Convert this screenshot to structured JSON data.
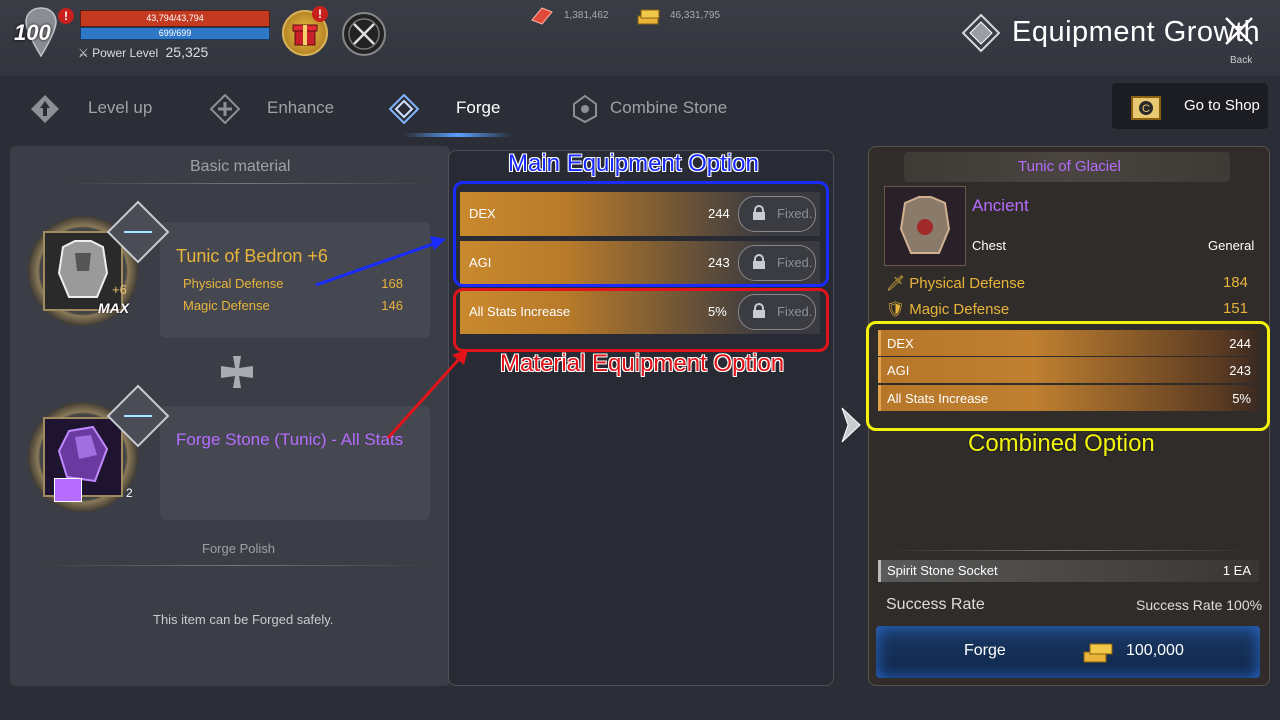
{
  "header": {
    "level": "100",
    "hp_text": "43,794/43,794",
    "mp_text": "699/699",
    "power_label": "Power Level",
    "power_value": "25,325",
    "currency1": "1,381,462",
    "currency2": "46,331,795",
    "title": "Equipment Growth",
    "back_label": "Back"
  },
  "tabs": [
    {
      "label": "Level up"
    },
    {
      "label": "Enhance"
    },
    {
      "label": "Forge"
    },
    {
      "label": "Combine Stone"
    }
  ],
  "shop": {
    "label": "Go to Shop"
  },
  "left": {
    "basic_material": "Basic material",
    "item1": {
      "name": "Tunic of Bedron +6",
      "level_badge": "+6",
      "max_badge": "MAX",
      "stat1_name": "Physical Defense",
      "stat1_value": "168",
      "stat2_name": "Magic Defense",
      "stat2_value": "146"
    },
    "item2": {
      "name": "Forge Stone (Tunic) - All Stats",
      "count": "2"
    },
    "forge_polish": "Forge Polish",
    "safe_text": "This item can be Forged safely."
  },
  "middle": {
    "options": [
      {
        "name": "DEX",
        "value": "244",
        "fixed": "Fixed."
      },
      {
        "name": "AGI",
        "value": "243",
        "fixed": "Fixed."
      },
      {
        "name": "All Stats Increase",
        "value": "5%",
        "fixed": "Fixed."
      }
    ]
  },
  "annotations": {
    "main": "Main Equipment Option",
    "material": "Material Equipment Option",
    "combined": "Combined Option"
  },
  "right": {
    "item_name": "Tunic of Glaciel",
    "grade": "Ancient",
    "slot": "Chest",
    "type": "General",
    "stat1_name": "Physical Defense",
    "stat1_value": "184",
    "stat2_name": "Magic Defense",
    "stat2_value": "151",
    "combined": [
      {
        "name": "DEX",
        "value": "244"
      },
      {
        "name": "AGI",
        "value": "243"
      },
      {
        "name": "All Stats Increase",
        "value": "5%"
      }
    ],
    "socket_label": "Spirit Stone Socket",
    "socket_value": "1 EA",
    "success_label": "Success Rate",
    "success_value": "Success Rate 100%",
    "forge_label": "Forge",
    "forge_cost": "100,000"
  },
  "colors": {
    "gold": "#e8b43a",
    "purple": "#b56cff",
    "annotation_blue": "#1a2bff",
    "annotation_red": "#e1141a",
    "annotation_yellow": "#f2f20e"
  }
}
